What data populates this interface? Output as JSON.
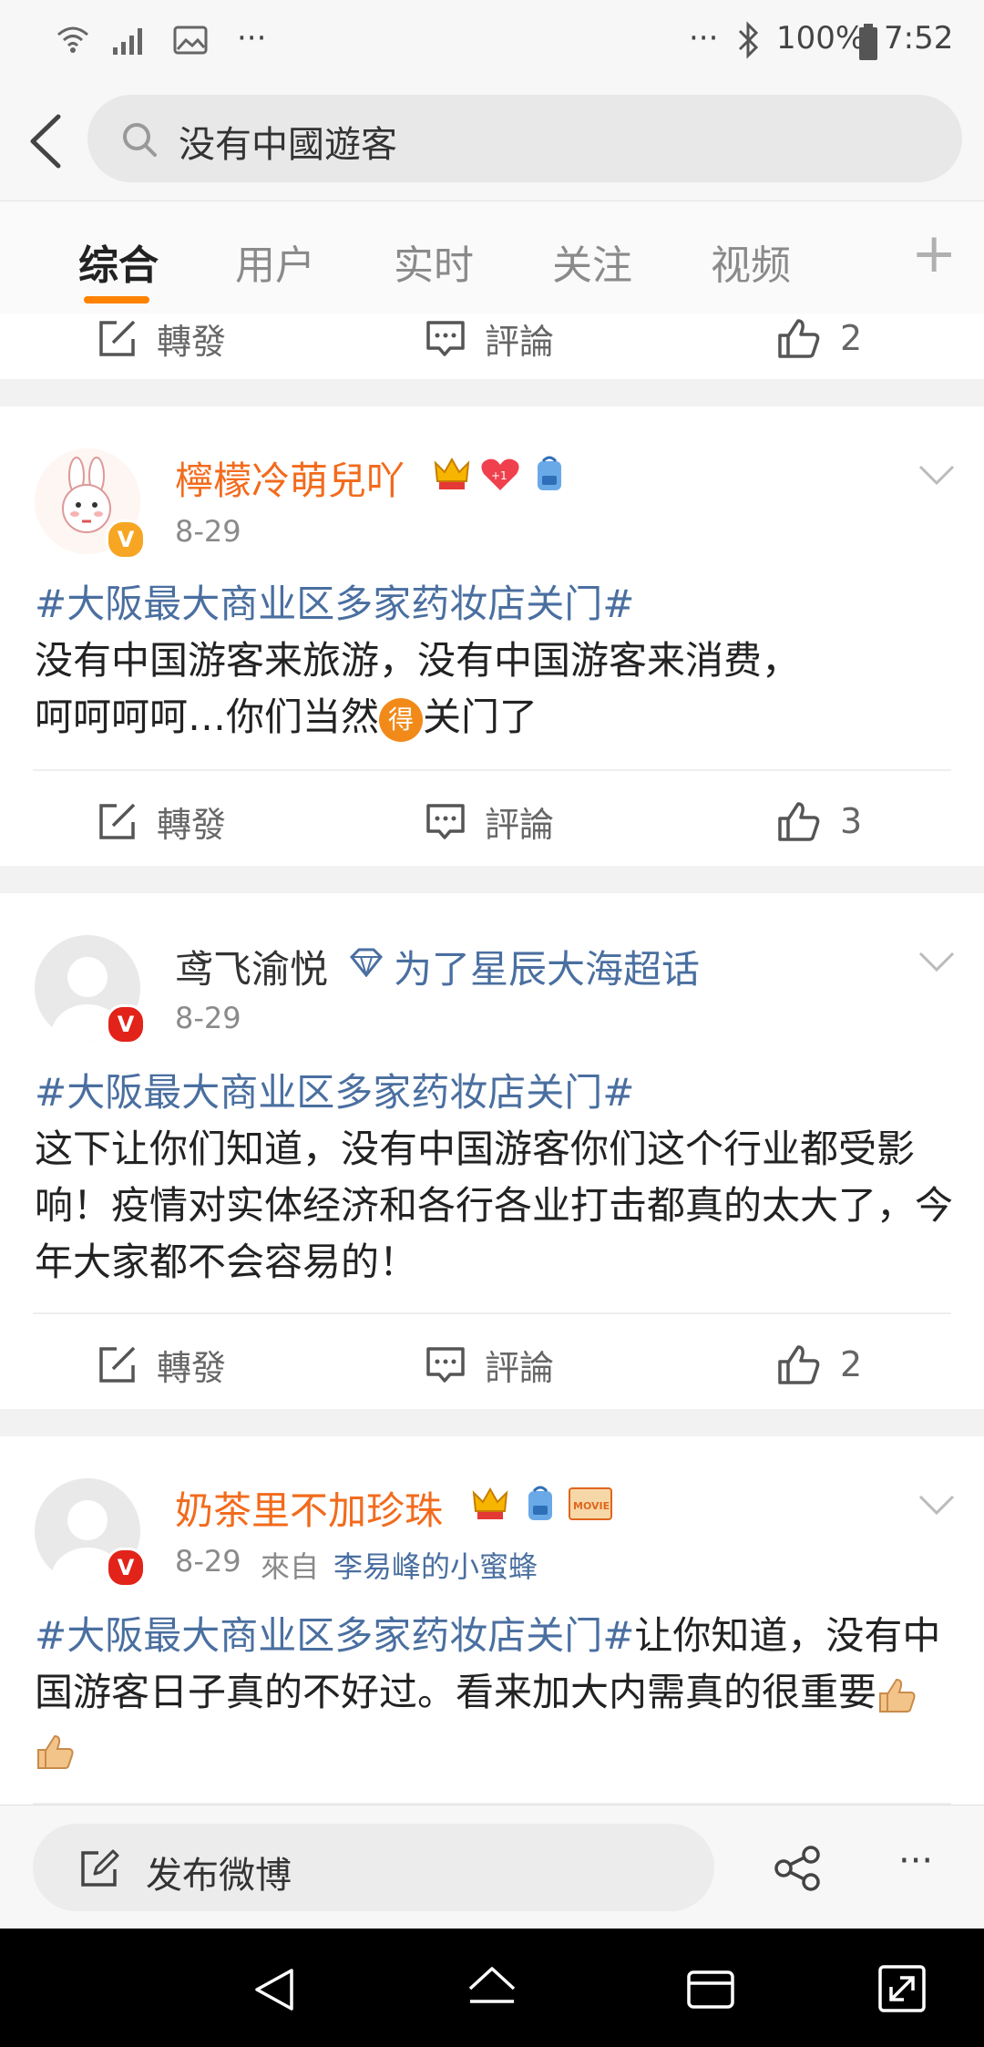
{
  "status_bar": {
    "battery": "100%",
    "time": "7:52",
    "more_left": "···",
    "more_right": "···"
  },
  "search": {
    "query": "没有中國遊客"
  },
  "tabs": [
    {
      "label": "综合"
    },
    {
      "label": "用户"
    },
    {
      "label": "实时"
    },
    {
      "label": "关注"
    },
    {
      "label": "视频"
    }
  ],
  "tab_add": "+",
  "action_labels": {
    "repost": "轉發",
    "comment": "評論"
  },
  "posts": [
    {
      "like_count": "2"
    },
    {
      "username": "檸檬冷萌兒吖",
      "date": "8-29",
      "topic": "#大阪最大商业区多家药妆店关门#",
      "text_1": "没有中国游客来旅游，没有中国游客来消费，",
      "text_2a": "呵呵呵呵…你们当然",
      "emoji": "得",
      "text_2b": "关门了",
      "like_count": "3",
      "badge": "V",
      "heart_label": "+1"
    },
    {
      "username": "鸢飞渝悦",
      "supertopic": "为了星辰大海超话",
      "date": "8-29",
      "topic": "#大阪最大商业区多家药妆店关门#",
      "text": "这下让你们知道，没有中国游客你们这个行业都受影响！疫情对实体经济和各行各业打击都真的太大了，今年大家都不会容易的！",
      "like_count": "2",
      "badge": "V"
    },
    {
      "username": "奶茶里不加珍珠",
      "date": "8-29",
      "source_prefix": "來自",
      "source": "李易峰的小蜜蜂",
      "topic": "#大阪最大商业区多家药妆店关门#",
      "text": "让你知道，没有中国游客日子真的不好过。看来加大内需真的很重要",
      "badge": "V",
      "movie_badge": "MOVIE"
    }
  ],
  "bottom": {
    "compose_label": "发布微博",
    "more": "···"
  },
  "colors": {
    "accent": "#ff8200",
    "username_orange": "#f26b1d",
    "topic_blue": "#4a6fa0"
  }
}
